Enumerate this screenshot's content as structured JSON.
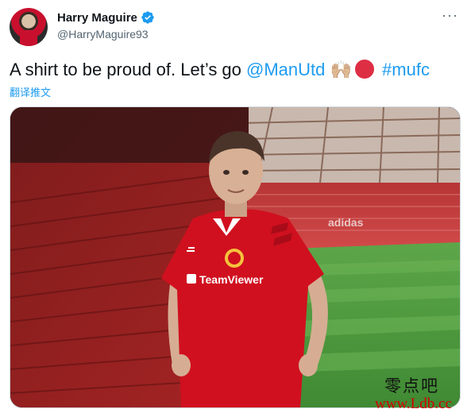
{
  "tweet": {
    "display_name": "Harry Maguire",
    "handle": "@HarryMaguire93",
    "more_icon": "more-horizontal-icon",
    "text_intro": "A shirt to be proud of. Let’s go ",
    "mention": "@ManUtd",
    "emoji_clap": "🙌🏼",
    "hashtag": "#mufc",
    "translate_label": "翻译推文"
  },
  "photo": {
    "shirt_logo": "TeamViewer",
    "board_text": "adidas"
  },
  "watermark": {
    "chinese": "零点吧",
    "url": "www.Ldb.cc"
  },
  "colors": {
    "link": "#1d9bf0",
    "verified": "#1d9bf0",
    "shirt_red": "#d0101f",
    "pitch_green": "#4f9a3e"
  }
}
